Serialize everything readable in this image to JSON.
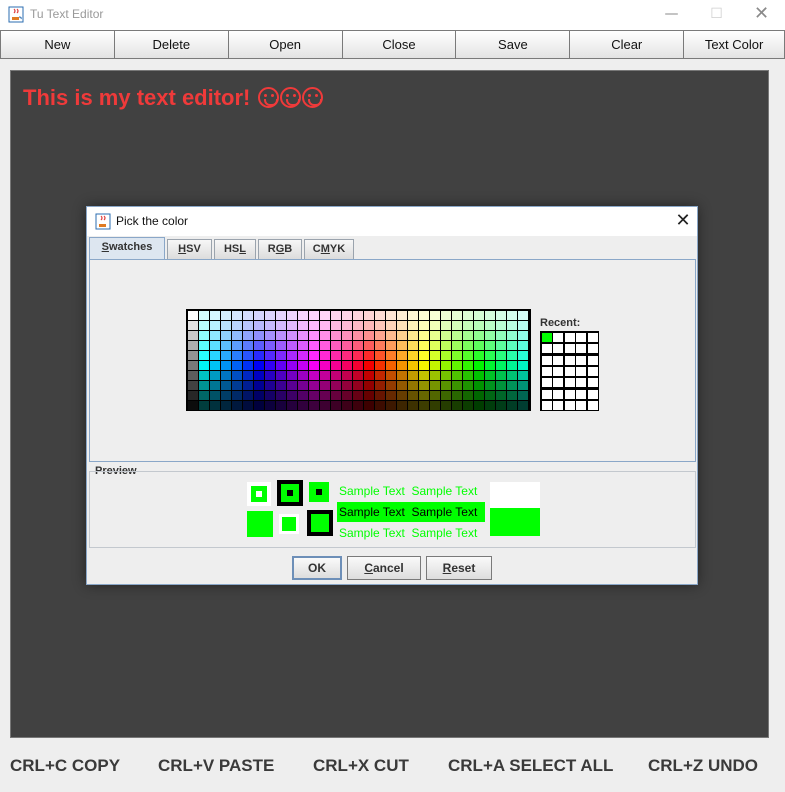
{
  "window": {
    "title": "Tu Text Editor",
    "controls": {
      "minimize": "—",
      "maximize": "☐",
      "close": "✕"
    }
  },
  "toolbar": {
    "buttons": [
      "New",
      "Delete",
      "Open",
      "Close",
      "Save",
      "Clear",
      "Text Color"
    ]
  },
  "editor": {
    "text": "This is my text editor!",
    "emojis": [
      "grinning-face",
      "grimacing-face",
      "grimacing-face"
    ],
    "background": "#414141",
    "text_color": "#ef3a3a"
  },
  "footer": {
    "shortcuts": [
      "CRL+C COPY",
      "CRL+V PASTE",
      "CRL+X CUT",
      "CRL+A SELECT ALL",
      "CRL+Z UNDO"
    ]
  },
  "dialog": {
    "title": "Pick the color",
    "close": "✕",
    "tabs": [
      {
        "label": "Swatches",
        "mnemonic": "S",
        "active": true
      },
      {
        "label": "HSV",
        "mnemonic": "H",
        "active": false
      },
      {
        "label": "HSL",
        "mnemonic": "L",
        "active": false
      },
      {
        "label": "RGB",
        "mnemonic": "G",
        "active": false
      },
      {
        "label": "CMYK",
        "mnemonic": "M",
        "active": false
      }
    ],
    "recent_label": "Recent:",
    "recent_colors": [
      "#00ff00"
    ],
    "preview_label": "Preview",
    "sample_text": "Sample Text",
    "selected_color": "#00ff00",
    "buttons": {
      "ok": "OK",
      "cancel": "Cancel",
      "reset": "Reset"
    }
  }
}
